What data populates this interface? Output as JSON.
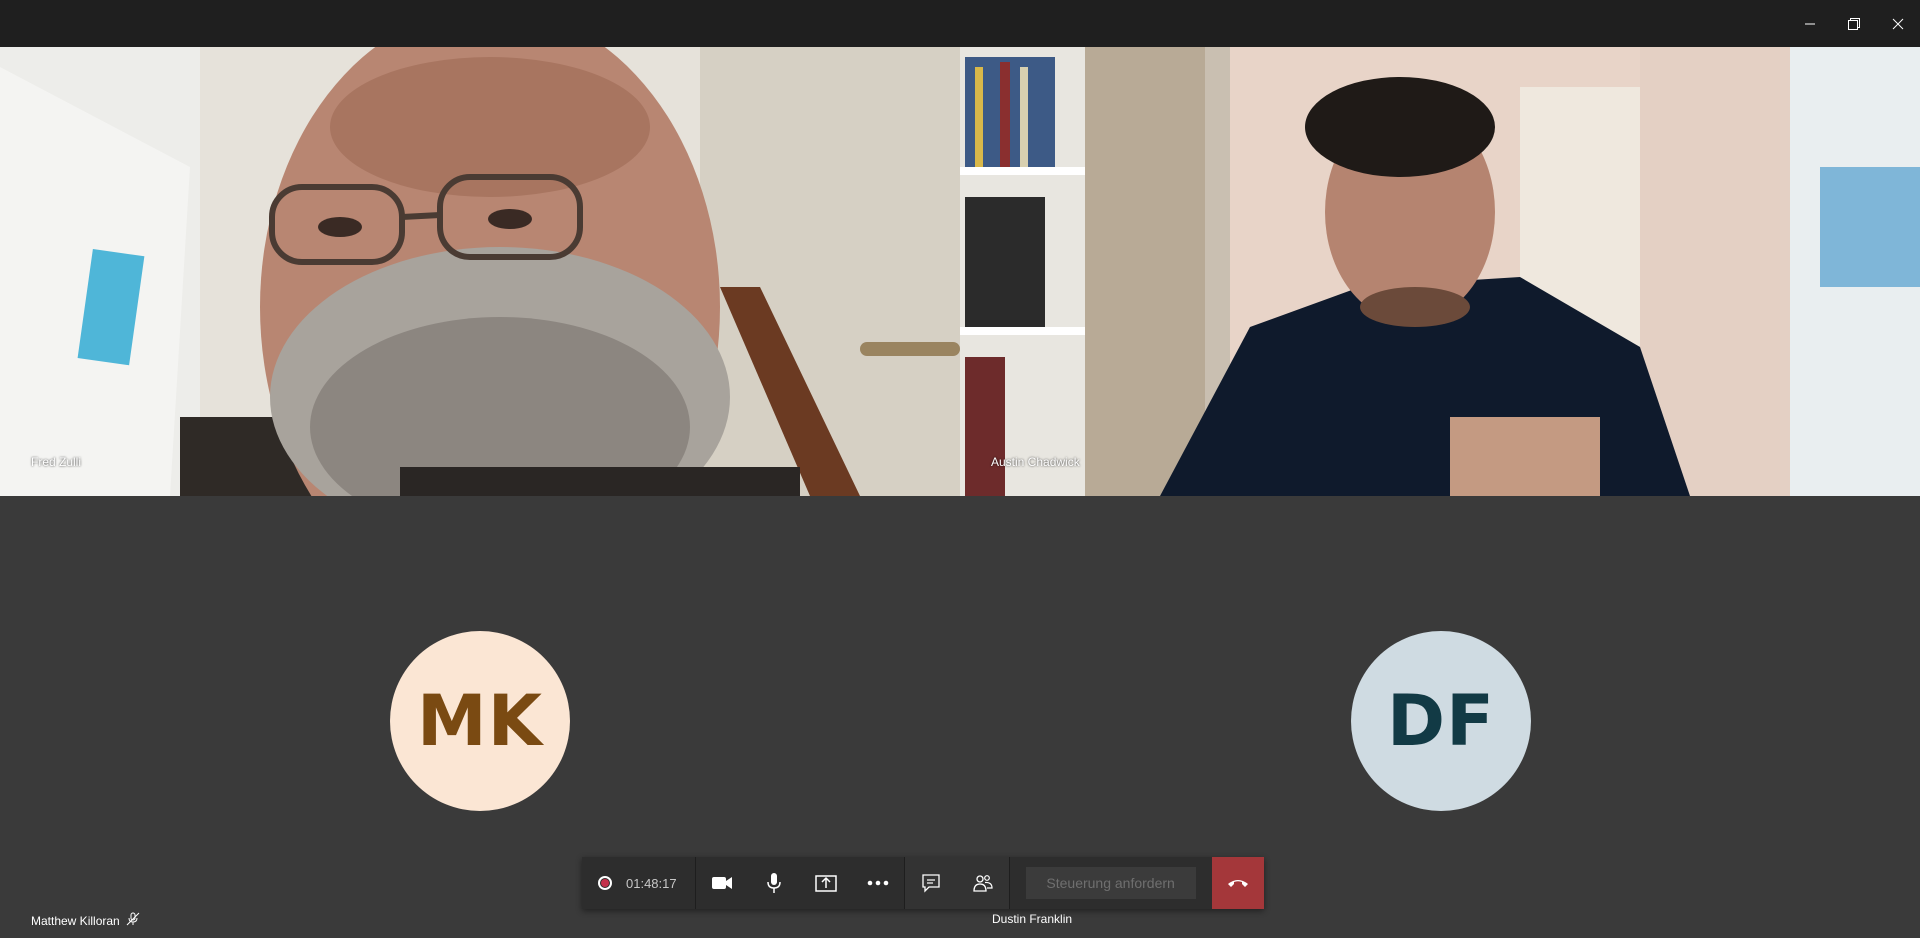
{
  "window": {
    "minimize_icon": "minimize-icon",
    "restore_icon": "restore-icon",
    "close_icon": "close-icon"
  },
  "participants": {
    "top_left": {
      "name": "Fred Zulli"
    },
    "top_right": {
      "name": "Austin Chadwick"
    },
    "bottom_left": {
      "name": "Matthew Killoran",
      "initials": "MK",
      "avatar_bg": "#fbe6d4",
      "avatar_fg": "#7a4a12",
      "muted": true
    },
    "bottom_right": {
      "name": "Dustin Franklin",
      "initials": "DF",
      "avatar_bg": "#cfdbe2",
      "avatar_fg": "#123a45"
    }
  },
  "callbar": {
    "recording_icon": "record-icon",
    "timer": "01:48:17",
    "camera_icon": "camera-icon",
    "mic_icon": "microphone-icon",
    "share_icon": "share-screen-icon",
    "more_icon": "more-options-icon",
    "chat_icon": "chat-icon",
    "participants_icon": "participants-icon",
    "request_control_label": "Steuerung anfordern",
    "hangup_icon": "hang-up-icon",
    "hangup_color": "#a4373a"
  }
}
